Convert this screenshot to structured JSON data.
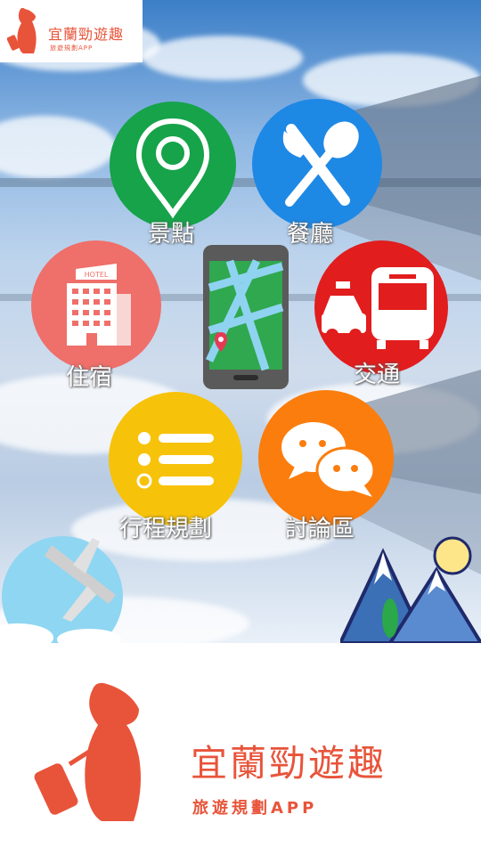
{
  "app": {
    "title": "宜蘭勁遊趣",
    "subtitle": "旅遊規劃APP"
  },
  "menu": {
    "attractions": "景點",
    "restaurants": "餐廳",
    "lodging": "住宿",
    "transport": "交通",
    "itinerary": "行程規劃",
    "forum": "討論區"
  },
  "hotel_sign": "HOTEL",
  "colors": {
    "attractions": "#16a34a",
    "restaurants": "#1e88e5",
    "lodging": "#ef6f6a",
    "transport": "#e11d1d",
    "itinerary": "#f7c20a",
    "forum": "#fb7d0d",
    "brand": "#e8543a"
  }
}
